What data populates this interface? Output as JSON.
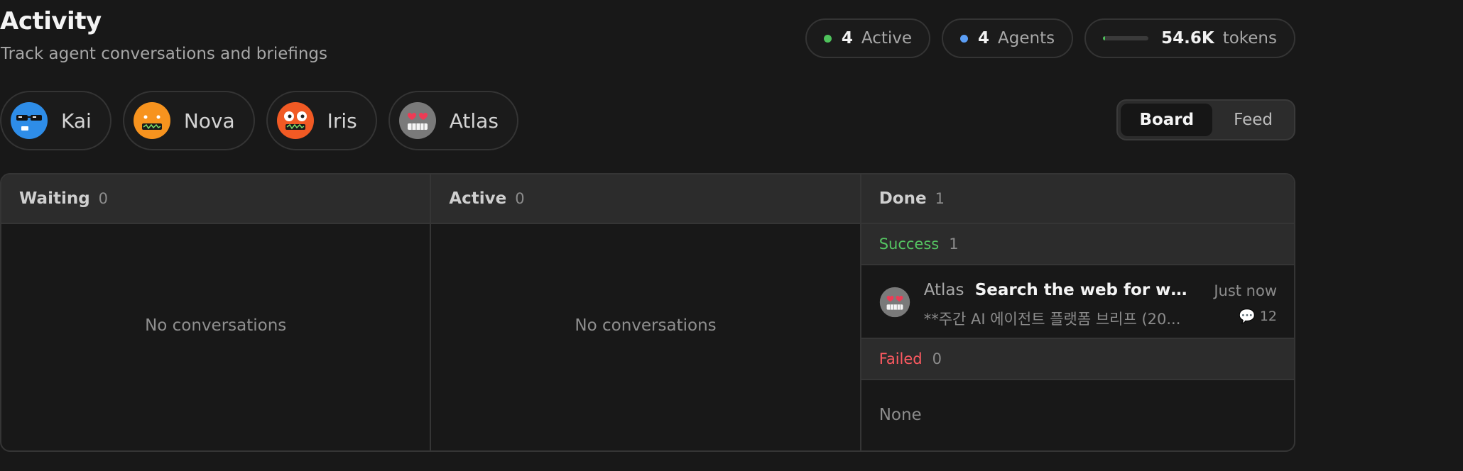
{
  "header": {
    "title": "Activity",
    "subtitle": "Track agent conversations and briefings"
  },
  "stats": {
    "active": {
      "value": "4",
      "label": "Active",
      "color": "#4ec25b"
    },
    "agents": {
      "value": "4",
      "label": "Agents",
      "color": "#5b9ef5"
    },
    "tokens": {
      "value": "54.6K",
      "label": "tokens",
      "usage_fraction": 0.05
    }
  },
  "agents": [
    {
      "name": "Kai",
      "icon": "sunglasses-face-icon",
      "color": "#2e8de8"
    },
    {
      "name": "Nova",
      "icon": "orange-robot-face-icon",
      "color": "#f7931e"
    },
    {
      "name": "Iris",
      "icon": "dizzy-face-icon",
      "color": "#f15a24"
    },
    {
      "name": "Atlas",
      "icon": "heart-eyes-robot-icon",
      "color": "#7a7a7a"
    }
  ],
  "view_toggle": {
    "options": [
      "Board",
      "Feed"
    ],
    "selected": "Board"
  },
  "board": {
    "columns": [
      {
        "title": "Waiting",
        "count": "0",
        "empty_text": "No conversations"
      },
      {
        "title": "Active",
        "count": "0",
        "empty_text": "No conversations"
      },
      {
        "title": "Done",
        "count": "1",
        "groups": {
          "success": {
            "label": "Success",
            "count": "1"
          },
          "failed": {
            "label": "Failed",
            "count": "0",
            "empty_text": "None"
          }
        },
        "items": [
          {
            "agent": "Atlas",
            "title": "Search the web for what ...",
            "time": "Just now",
            "preview": "**주간 AI 에이전트 플랫폼 브리프 (20...",
            "messages": "12",
            "icon": "heart-eyes-robot-icon"
          }
        ]
      }
    ]
  }
}
